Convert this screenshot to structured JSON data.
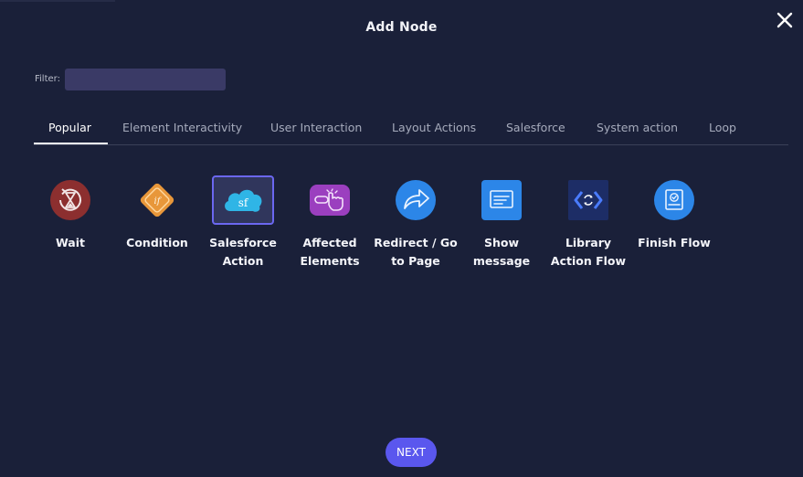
{
  "dialog": {
    "title": "Add Node"
  },
  "filter": {
    "label": "Filter:",
    "value": ""
  },
  "tabs": [
    {
      "label": "Popular",
      "active": true
    },
    {
      "label": "Element Interactivity",
      "active": false
    },
    {
      "label": "User Interaction",
      "active": false
    },
    {
      "label": "Layout Actions",
      "active": false
    },
    {
      "label": "Salesforce",
      "active": false
    },
    {
      "label": "System action",
      "active": false
    },
    {
      "label": "Loop",
      "active": false
    }
  ],
  "nodes": [
    {
      "label": "Wait",
      "icon": "hourglass-icon",
      "color": "#8c2f2f"
    },
    {
      "label": "Condition",
      "icon": "condition-diamond-icon",
      "color": "#e8973a"
    },
    {
      "label": "Salesforce Action",
      "icon": "salesforce-cloud-icon",
      "color": "#2fb5e6",
      "selected": true
    },
    {
      "label": "Affected Elements",
      "icon": "pointer-hand-icon",
      "color": "#9b3fbf"
    },
    {
      "label": "Redirect / Go to Page",
      "icon": "redirect-arrow-icon",
      "color": "#2c86e8"
    },
    {
      "label": "Show message",
      "icon": "message-icon",
      "color": "#2c86e8"
    },
    {
      "label": "Library Action Flow",
      "icon": "library-flow-icon",
      "color": "#1d2d66"
    },
    {
      "label": "Finish Flow",
      "icon": "finish-flow-icon",
      "color": "#2c86e8"
    }
  ],
  "footer": {
    "next_label": "NEXT"
  }
}
